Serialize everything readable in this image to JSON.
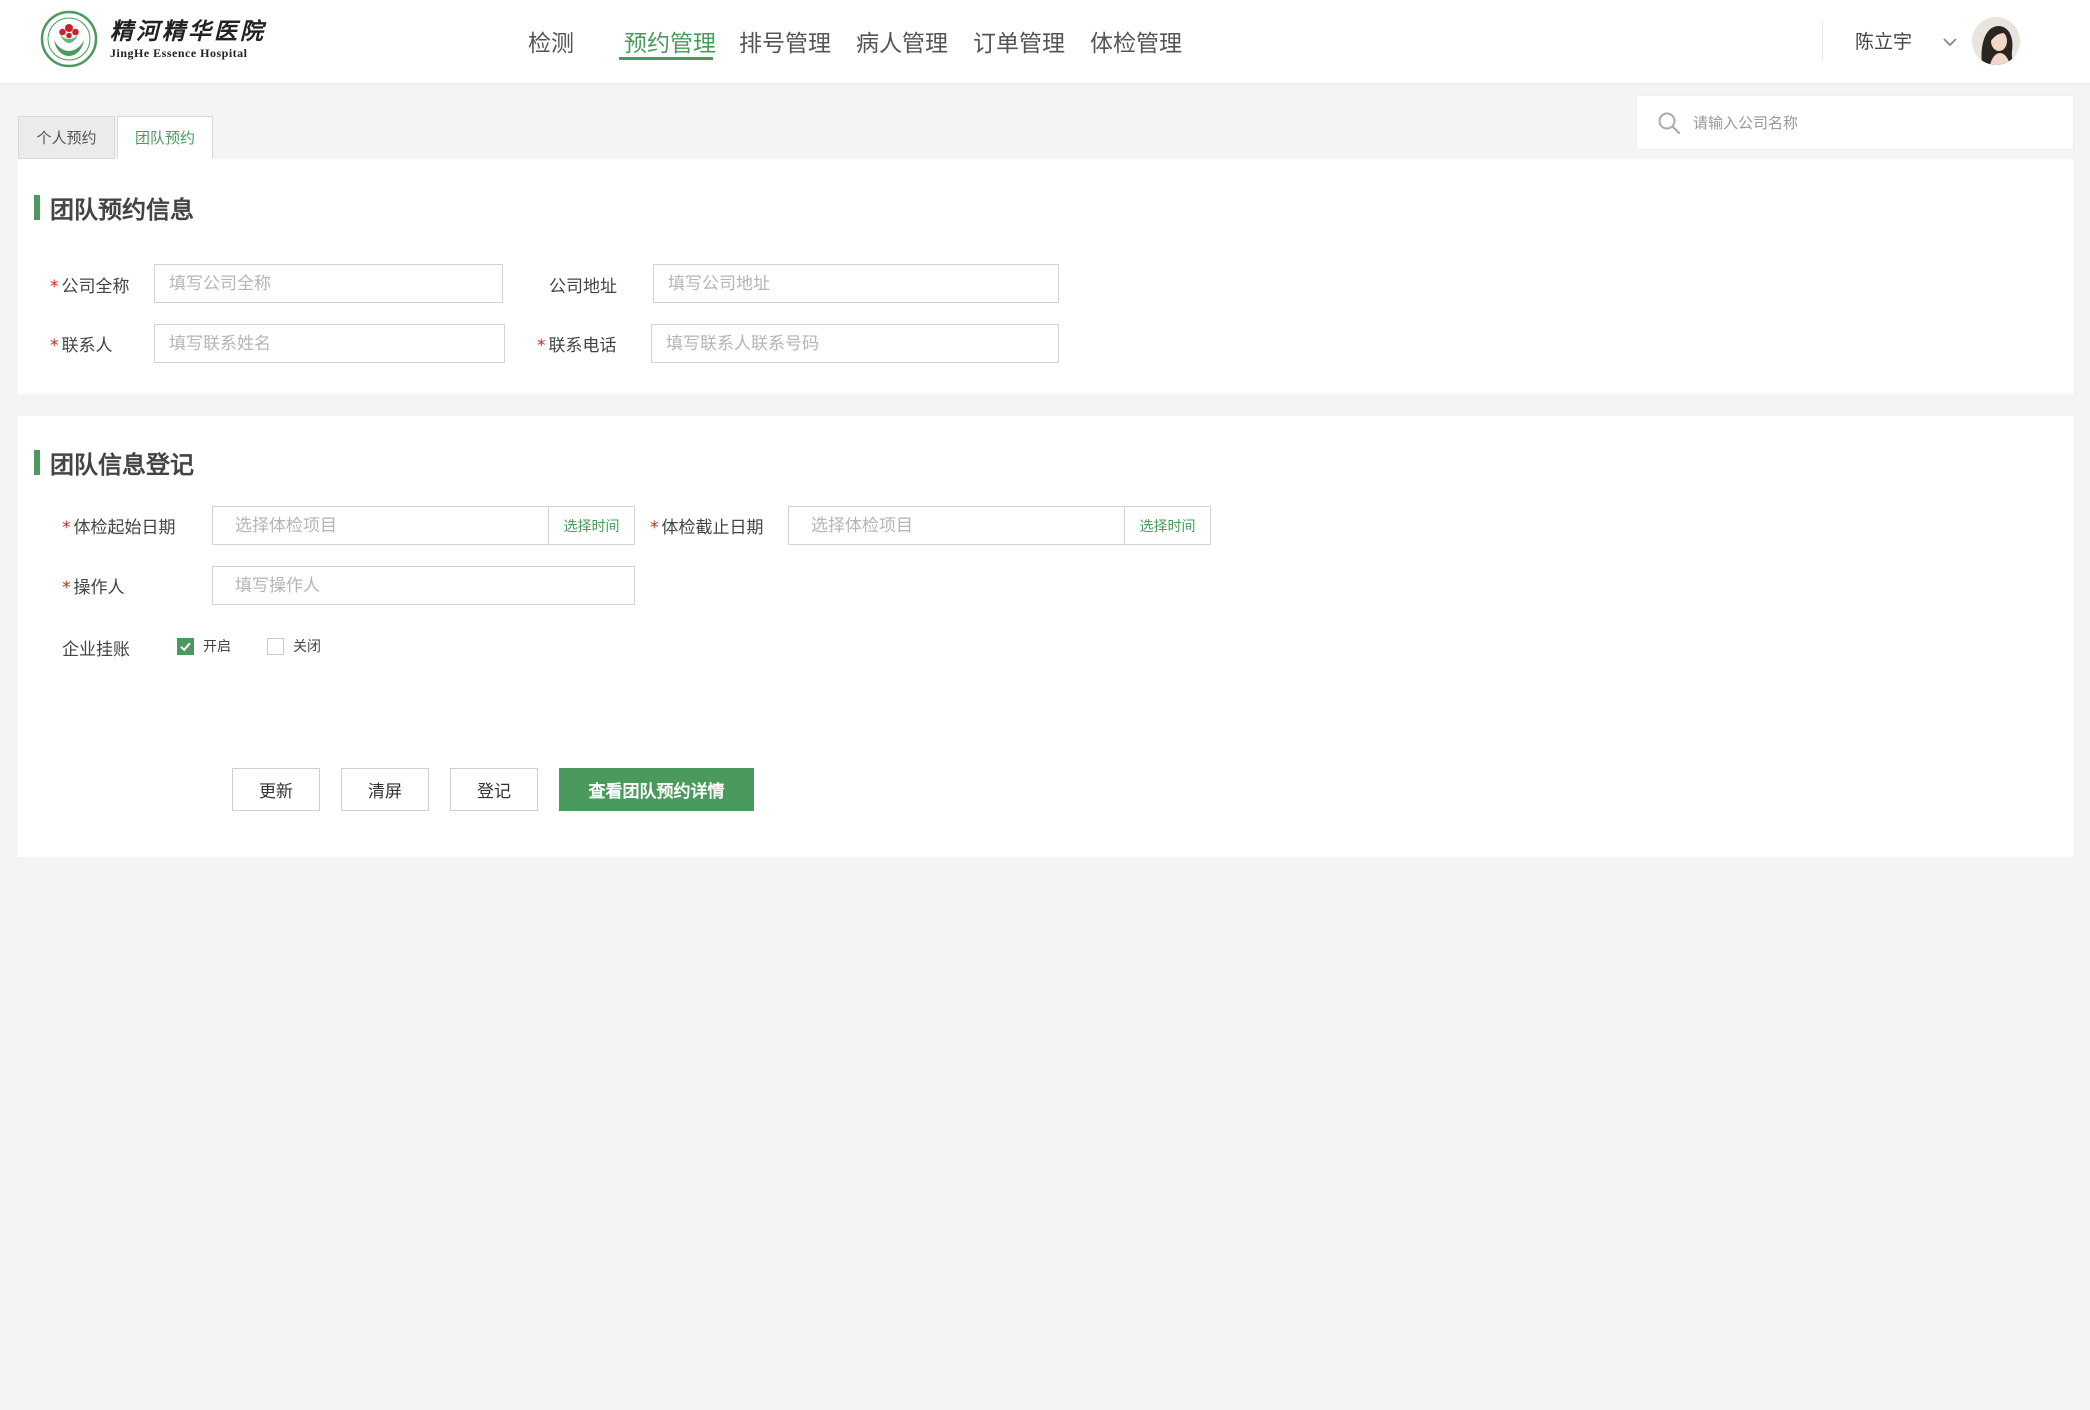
{
  "brand": {
    "name_cn": "精河精华医院",
    "name_en": "JingHe Essence Hospital"
  },
  "nav": {
    "items": [
      {
        "label": "检测"
      },
      {
        "label": "预约管理",
        "active": true
      },
      {
        "label": "排号管理"
      },
      {
        "label": "病人管理"
      },
      {
        "label": "订单管理"
      },
      {
        "label": "体检管理"
      }
    ]
  },
  "user": {
    "name": "陈立宇"
  },
  "tabs": [
    {
      "label": "个人预约"
    },
    {
      "label": "团队预约",
      "active": true
    }
  ],
  "search": {
    "placeholder": "请输入公司名称",
    "value": ""
  },
  "team_info": {
    "title": "团队预约信息",
    "company_name": {
      "label": "公司全称",
      "placeholder": "填写公司全称",
      "value": "",
      "required": true
    },
    "company_address": {
      "label": "公司地址",
      "placeholder": "填写公司地址",
      "value": "",
      "required": false
    },
    "contact_person": {
      "label": "联系人",
      "placeholder": "填写联系姓名",
      "value": "",
      "required": true
    },
    "contact_phone": {
      "label": "联系电话",
      "placeholder": "填写联系人联系号码",
      "value": "",
      "required": true
    }
  },
  "team_register": {
    "title": "团队信息登记",
    "start_date": {
      "label": "体检起始日期",
      "placeholder": "选择体检项目",
      "value": "",
      "button": "选择时间",
      "required": true
    },
    "end_date": {
      "label": "体检截止日期",
      "placeholder": "选择体检项目",
      "value": "",
      "button": "选择时间",
      "required": true
    },
    "operator": {
      "label": "操作人",
      "placeholder": "填写操作人",
      "value": "",
      "required": true
    },
    "credit": {
      "label": "企业挂账",
      "options": [
        {
          "label": "开启",
          "checked": true
        },
        {
          "label": "关闭",
          "checked": false
        }
      ]
    }
  },
  "actions": {
    "update": "更新",
    "clear": "清屏",
    "register": "登记",
    "view_details": "查看团队预约详情"
  },
  "colors": {
    "accent": "#4a9a5e",
    "required": "#e02020",
    "background": "#f4f4f4"
  }
}
